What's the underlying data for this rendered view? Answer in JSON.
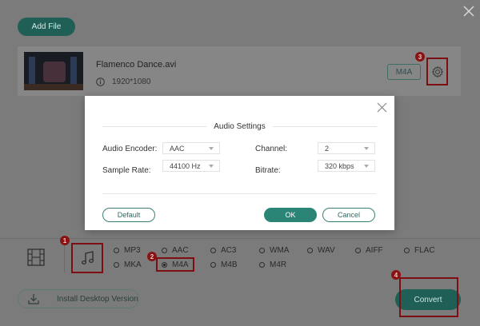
{
  "toolbar": {
    "add_file_label": "Add File"
  },
  "file": {
    "name": "Flamenco Dance.avi",
    "resolution": "1920*1080",
    "format_badge": "M4A"
  },
  "callouts": {
    "c1": "1",
    "c2": "2",
    "c3": "3",
    "c4": "4"
  },
  "formats": {
    "row1": [
      "MP3",
      "AAC",
      "AC3",
      "WMA",
      "WAV",
      "AIFF",
      "FLAC"
    ],
    "row2": [
      "MKA",
      "M4A",
      "M4B",
      "M4R"
    ],
    "selected": "M4A"
  },
  "footer": {
    "install_label": "Install Desktop Version",
    "convert_label": "Convert"
  },
  "dialog": {
    "title": "Audio Settings",
    "encoder_label": "Audio Encoder:",
    "encoder_value": "AAC",
    "sample_rate_label": "Sample Rate:",
    "sample_rate_value": "44100 Hz",
    "channel_label": "Channel:",
    "channel_value": "2",
    "bitrate_label": "Bitrate:",
    "bitrate_value": "320 kbps",
    "default_label": "Default",
    "ok_label": "OK",
    "cancel_label": "Cancel"
  },
  "colors": {
    "accent": "#2b8577",
    "highlight": "#7b0f12",
    "overlay": "#7b7b7b"
  }
}
